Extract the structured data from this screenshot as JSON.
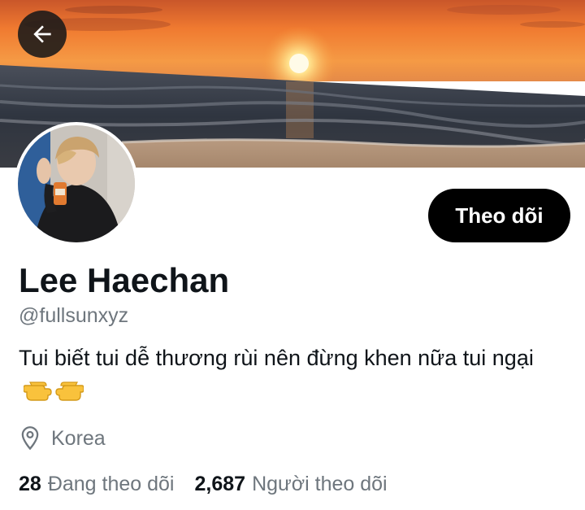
{
  "header": {
    "back_icon": "arrow-left-icon",
    "banner_description": "sunset-over-sea"
  },
  "profile": {
    "display_name": "Lee Haechan",
    "handle": "@fullsunxyz",
    "bio": "Tui biết tui dễ thương rùi nên đừng khen nữa tui ngại",
    "bio_emoji": [
      "pointing-right-hand-emoji",
      "pointing-left-hand-emoji"
    ],
    "location_icon": "location-pin-icon",
    "location": "Korea",
    "follow_button": "Theo dõi"
  },
  "stats": {
    "following_count": "28",
    "following_label": "Đang theo dõi",
    "followers_count": "2,687",
    "followers_label": "Người theo dõi"
  },
  "colors": {
    "text_primary": "#0f1419",
    "text_secondary": "#6e767d",
    "button_bg": "#000000",
    "button_text": "#ffffff"
  }
}
